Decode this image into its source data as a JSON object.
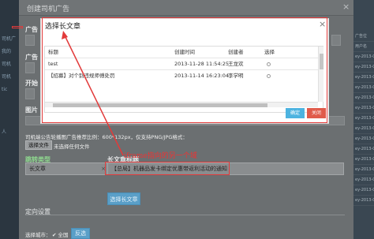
{
  "background": {
    "left_items": [
      "司机广",
      "我的",
      "司机",
      "司机",
      "ne2page",
      "tic",
      "人"
    ],
    "right_rows": [
      "广告位",
      "用户名",
      "ey-2013-07-04",
      "ey-2013-07-04",
      "ey-2013-07-04",
      "ey-2013-07-04",
      "ey-2013-07-04",
      "ey-2013-07-04",
      "ey-2013-07-04",
      "ey-2013-07-04",
      "ey-2013-07-04",
      "ey-2013-07-04",
      "ey-2013-07-04",
      "ey-2013-07-04",
      "ey-2013-07-04",
      "ey-2013-07-04",
      "ey-2013-07-04"
    ]
  },
  "outer": {
    "title": "创建司机广告",
    "close": "×",
    "labels": {
      "guanggao": "广告",
      "guanggao2": "广告",
      "kaishi": "开始",
      "tupian": "图片"
    },
    "upload_hint": "司机端公告轮播图广告推荐比例：600*132px，仅支持PNG/JPG格式：",
    "choose_file": "选择文件",
    "no_file": "未选择任何文件",
    "ad_type_label": "跳转类型",
    "ad_type_value": "长文章",
    "ad_type_clear": "×",
    "ad_type_arrow": "▼",
    "article_title_label": "长文章标题",
    "article_title_value": "【总局】机器品发卡绑定优惠带返利活动的通知",
    "select_article_button": "选择长文章",
    "targeting_title": "定向设置",
    "select_city_label": "选择城市：",
    "all_label": "全国",
    "invert_button": "反选"
  },
  "inner": {
    "title": "选择长文章",
    "close": "×",
    "columns": [
      "标题",
      "创建时间",
      "创建者",
      "选择"
    ],
    "rows": [
      {
        "title": "test",
        "created": "2013-11-28 11:54:25",
        "author": "王龙欢"
      },
      {
        "title": "【招募】对个别违规师傅处罚",
        "created": "2013-11-14 16:23:04",
        "author": "李学明"
      }
    ],
    "confirm": "确定",
    "close_button": "关闭"
  },
  "annotation": {
    "text": "iframe指向的另一个域"
  },
  "colors": {
    "annotation_red": "#e23a3a",
    "confirm_blue": "#4db3e0",
    "close_red": "#e05a4a",
    "select_blue": "#5a9fc8"
  }
}
